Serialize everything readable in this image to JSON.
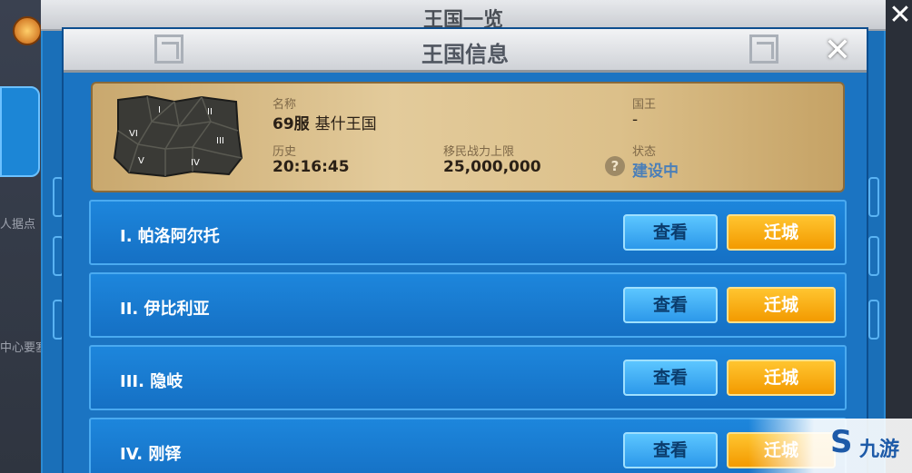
{
  "background": {
    "left_texts": [
      "人据点",
      "中心要塞"
    ]
  },
  "back_panel": {
    "title": "王国一览",
    "close": "✕"
  },
  "panel": {
    "title": "王国信息",
    "close": "✕"
  },
  "info": {
    "map_labels": [
      "I",
      "II",
      "III",
      "IV",
      "V",
      "VI"
    ],
    "name_label": "名称",
    "name_server": "69服",
    "name_value": "基什王国",
    "history_label": "历史",
    "history_value": "20:16:45",
    "migration_label": "移民战力上限",
    "migration_value": "25,000,000",
    "king_label": "国王",
    "king_value": "-",
    "status_label": "状态",
    "status_value": "建设中",
    "help": "?"
  },
  "regions": [
    {
      "name": "I. 帕洛阿尔托",
      "view": "查看",
      "move": "迁城"
    },
    {
      "name": "II. 伊比利亚",
      "view": "查看",
      "move": "迁城"
    },
    {
      "name": "III. 隐岐",
      "view": "查看",
      "move": "迁城"
    },
    {
      "name": "IV. 刚铎",
      "view": "查看",
      "move": "迁城"
    }
  ],
  "watermark": {
    "symbol": "S",
    "text": "九游"
  },
  "colors": {
    "panel_blue": "#1b74c2",
    "view_button": "#2c98ea",
    "move_button": "#f39a00",
    "parchment": "#e3cb9b"
  }
}
